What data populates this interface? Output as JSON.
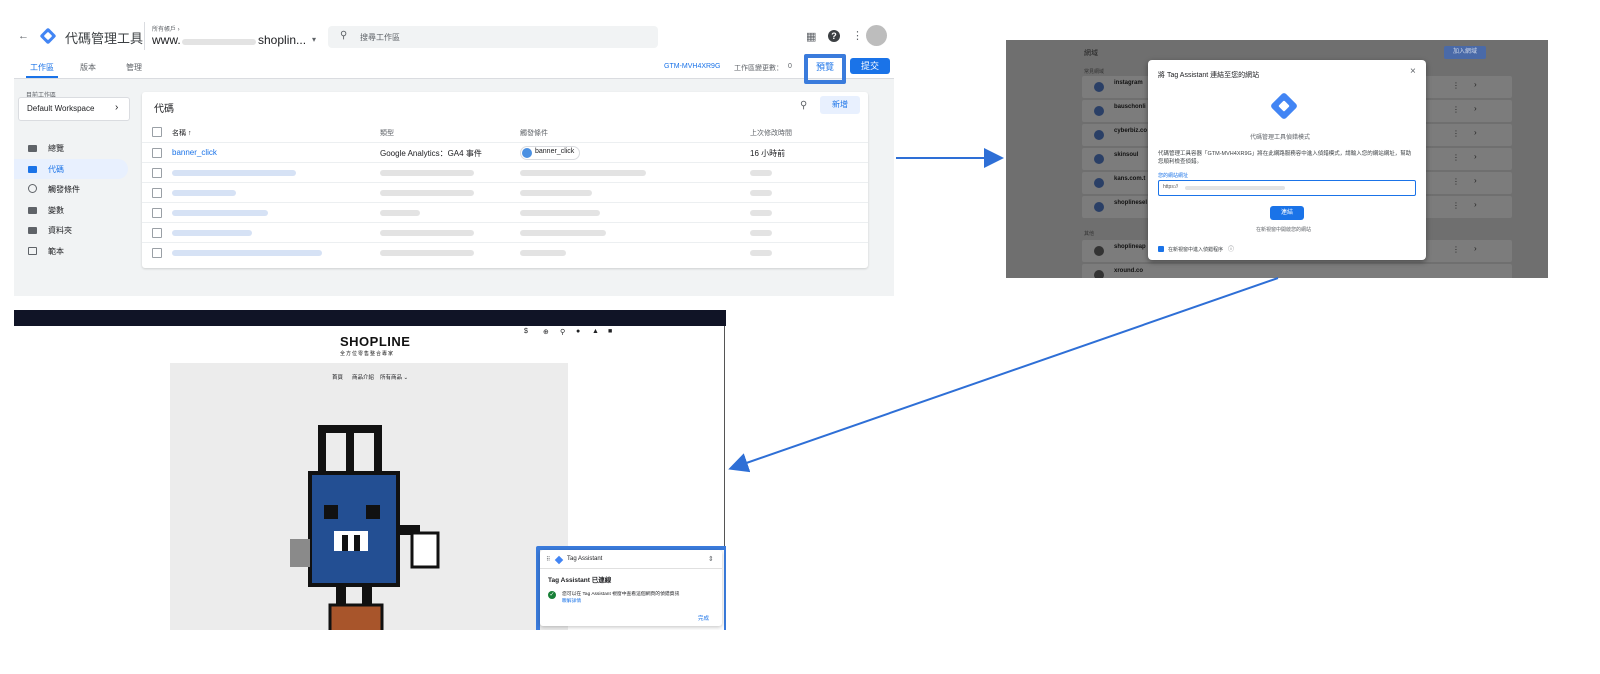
{
  "gtm": {
    "app_title": "代碼管理工具",
    "account_label": "所有帳戶 ›",
    "container_prefix": "www.",
    "container_suffix": "shoplin...",
    "search_placeholder": "搜尋工作區",
    "tabs": [
      "工作區",
      "版本",
      "管理"
    ],
    "container_id": "GTM-MVH4XR9G",
    "changes_label": "工作區變更數：",
    "changes_count": "0",
    "preview_label": "預覽",
    "submit_label": "提交",
    "workspace_section_label": "目前工作區",
    "workspace_name": "Default Workspace",
    "sidebar": [
      "總覽",
      "代碼",
      "觸發條件",
      "變數",
      "資料夾",
      "範本"
    ],
    "card_title": "代碼",
    "new_button": "新增",
    "columns": [
      "名稱 ↑",
      "類型",
      "觸發條件",
      "上次修改時間"
    ],
    "first_row": {
      "name": "banner_click",
      "type": "Google Analytics：GA4 事件",
      "trigger": "banner_click",
      "modified": "16 小時前"
    }
  },
  "tag_assistant": {
    "list_header": "網域",
    "add_domain": "加入網域",
    "section_recent": "常見網域",
    "section_other": "其他",
    "domains": [
      "instagram",
      "bauschonli",
      "cyberbiz.co",
      "skinsoul",
      "kans.com.t",
      "shoplinesel",
      "shoplineap",
      "xround.co"
    ],
    "dialog_title": "將 Tag Assistant 連結至您的網站",
    "dialog_subtitle": "代碼管理工具偵錯模式",
    "dialog_body": "代碼管理工具容器「GTM-MVH4XR9G」將在此網路服務容中進入偵錯模式，請輸入您的網站網址，幫助您順利檢查偵錯。",
    "url_label": "您的網站網址",
    "url_value": "https://",
    "connect_button": "連結",
    "footer_link": "在新視窗中開啟您的網站",
    "checkbox_label": "在新視窗中進入偵錯程序"
  },
  "shopline": {
    "logo": "SHOPLINE",
    "tagline": "全方位零售整合專家",
    "currency": "$",
    "nav": [
      "首頁",
      "商品介紹",
      "所有商品 ⌄"
    ],
    "popup_app": "Tag Assistant",
    "popup_title": "Tag Assistant 已連線",
    "popup_body": "您可以在 Tag Assistant 視窗中查看這個網頁的偵錯資訊",
    "popup_link": "瞭解詳情",
    "popup_done": "完成"
  },
  "colors": {
    "gtm_blue": "#1a73e8",
    "highlight": "#3a7bdc",
    "shop_bar": "#101426",
    "success": "#188038"
  }
}
